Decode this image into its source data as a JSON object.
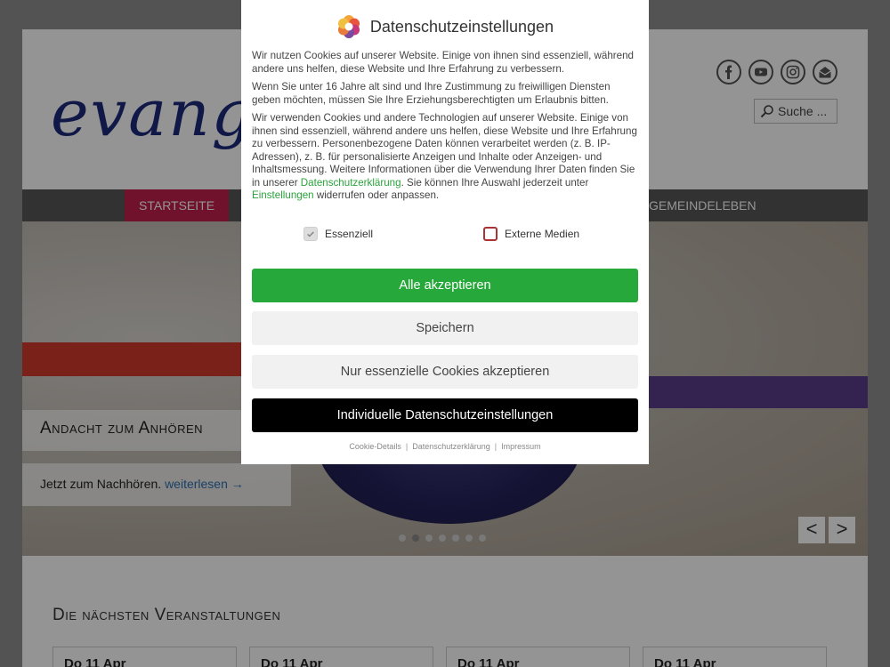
{
  "site": {
    "logo_text": "evange",
    "search_placeholder": "Suche ...",
    "socials": [
      "facebook-icon",
      "youtube-icon",
      "instagram-icon",
      "newsletter-icon"
    ]
  },
  "nav": {
    "items": [
      {
        "label": "STARTSEITE"
      },
      {
        "label": "GEMEINDELEBEN"
      }
    ]
  },
  "slider": {
    "title": "Andacht zum Anhören",
    "text": "Jetzt zum Nachhören.",
    "link": "weiterlesen →",
    "prev": "<",
    "next": ">",
    "dot_count": 7,
    "active_dot": 2
  },
  "events": {
    "title": "Die nächsten Veranstaltungen",
    "cards": [
      {
        "date": "Do 11 Apr"
      },
      {
        "date": "Do 11 Apr"
      },
      {
        "date": "Do 11 Apr"
      },
      {
        "date": "Do 11 Apr"
      }
    ]
  },
  "dialog": {
    "title": "Datenschutzeinstellungen",
    "p1": "Wir nutzen Cookies auf unserer Website. Einige von ihnen sind essenziell, während andere uns helfen, diese Website und Ihre Erfahrung zu verbessern.",
    "p2": "Wenn Sie unter 16 Jahre alt sind und Ihre Zustimmung zu freiwilligen Diensten geben möchten, müssen Sie Ihre Erziehungsberechtigten um Erlaubnis bitten.",
    "p3a": "Wir verwenden Cookies und andere Technologien auf unserer Website. Einige von ihnen sind essenziell, während andere uns helfen, diese Website und Ihre Erfahrung zu verbessern. Personenbezogene Daten können verarbeitet werden (z. B. IP-Adressen), z. B. für personalisierte Anzeigen und Inhalte oder Anzeigen- und Inhaltsmessung. Weitere Informationen über die Verwendung Ihrer Daten finden Sie in unserer ",
    "p3_link1": "Datenschutzerklärung",
    "p3b": ". Sie können Ihre Auswahl jederzeit unter ",
    "p3_link2": "Einstellungen",
    "p3c": " widerrufen oder anpassen.",
    "check_essential": "Essenziell",
    "check_external": "Externe Medien",
    "btn_accept_all": "Alle akzeptieren",
    "btn_save": "Speichern",
    "btn_essential_only": "Nur essenzielle Cookies akzeptieren",
    "btn_individual": "Individuelle Datenschutzeinstellungen",
    "footer_cookie_details": "Cookie-Details",
    "footer_privacy": "Datenschutzerklärung",
    "footer_imprint": "Impressum",
    "footer_sep": "|"
  },
  "colors": {
    "accent_green": "#27a83a",
    "nav_active": "#c21f4a",
    "nav_bg": "#575757"
  }
}
